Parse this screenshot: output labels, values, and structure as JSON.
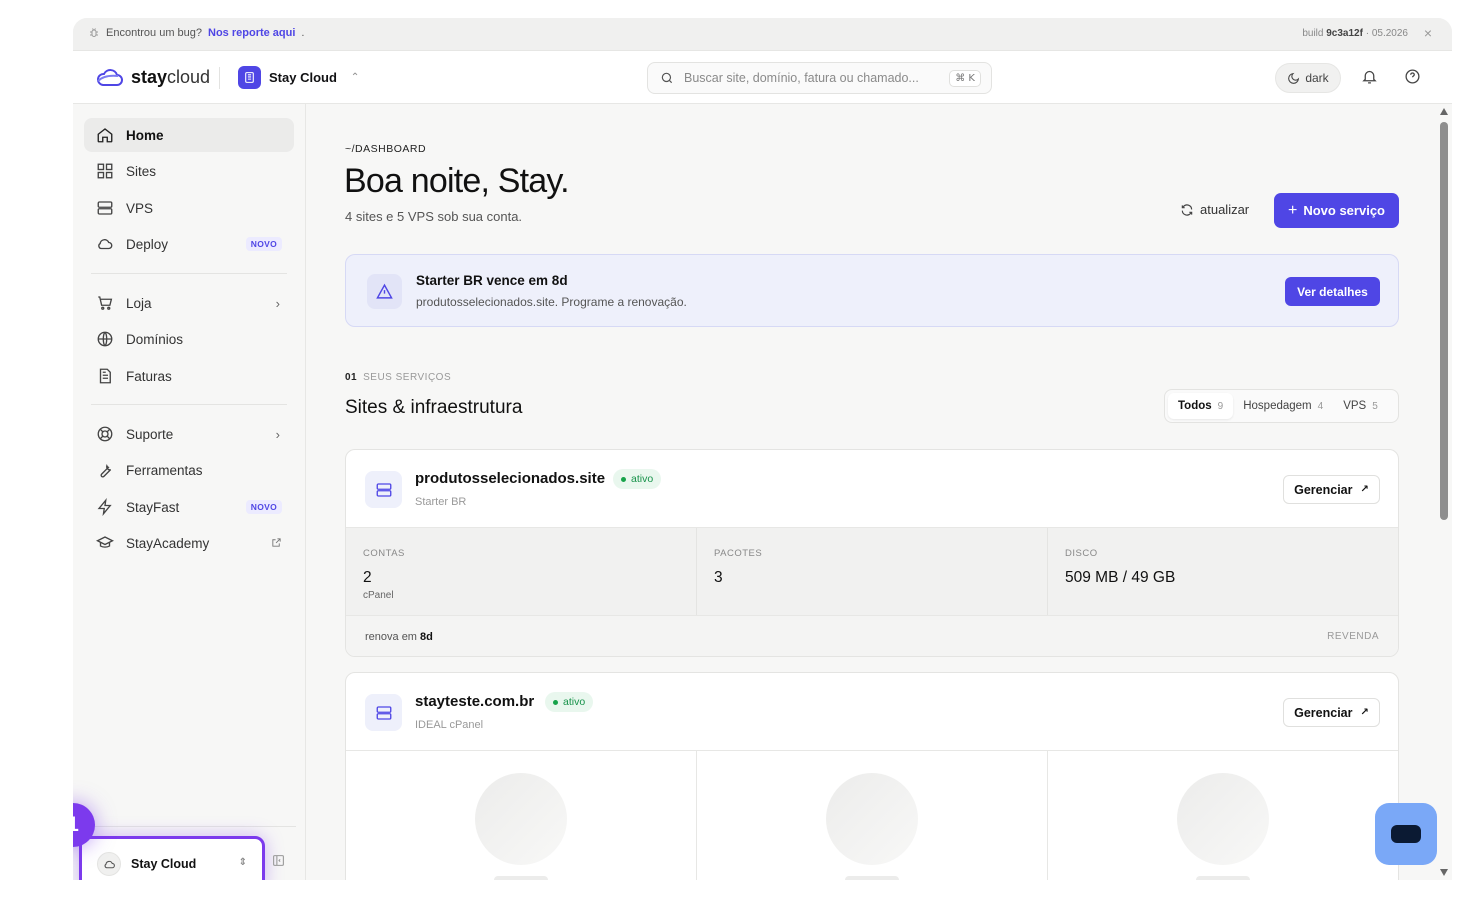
{
  "banner": {
    "bug_text": "Encontrou um bug?",
    "bug_link": "Nos reporte aqui",
    "bug_dot": ".",
    "build_label": "build",
    "build_hash": "9c3a12f",
    "build_date": "· 05.2026",
    "close": "×"
  },
  "header": {
    "logo_bold": "stay",
    "logo_light": "cloud",
    "org_name": "Stay Cloud",
    "search_placeholder": "Buscar site, domínio, fatura ou chamado...",
    "search_shortcut": "⌘ K",
    "theme_label": "dark"
  },
  "sidebar": {
    "items": [
      {
        "label": "Home",
        "icon": "home-icon",
        "active": true
      },
      {
        "label": "Sites",
        "icon": "grid-icon"
      },
      {
        "label": "VPS",
        "icon": "server-icon"
      },
      {
        "label": "Deploy",
        "icon": "cloud-icon",
        "tag": "NOVO"
      },
      {
        "label": "Loja",
        "icon": "cart-icon",
        "chevron": true
      },
      {
        "label": "Domínios",
        "icon": "globe-icon"
      },
      {
        "label": "Faturas",
        "icon": "invoice-icon"
      },
      {
        "label": "Suporte",
        "icon": "lifebuoy-icon",
        "chevron": true
      },
      {
        "label": "Ferramentas",
        "icon": "wrench-icon"
      },
      {
        "label": "StayFast",
        "icon": "bolt-icon",
        "tag": "NOVO"
      },
      {
        "label": "StayAcademy",
        "icon": "graduation-icon",
        "external": true
      }
    ],
    "org_switcher": "Stay Cloud",
    "step_number": "1"
  },
  "main": {
    "breadcrumb": "~/DASHBOARD",
    "greeting": "Boa noite, Stay.",
    "summary": "4 sites e 5 VPS sob sua conta.",
    "refresh_label": "atualizar",
    "new_service_label": "Novo serviço",
    "alert": {
      "title": "Starter BR vence em 8d",
      "text": "produtosselecionados.site. Programe a renovação.",
      "button": "Ver detalhes"
    },
    "section": {
      "number": "01",
      "kicker": "SEUS SERVIÇOS",
      "title": "Sites & infraestrutura"
    },
    "filters": [
      {
        "label": "Todos",
        "count": "9",
        "active": true
      },
      {
        "label": "Hospedagem",
        "count": "4"
      },
      {
        "label": "VPS",
        "count": "5"
      }
    ],
    "cards": [
      {
        "name": "produtosselecionados.site",
        "status": "ativo",
        "plan": "Starter BR",
        "manage_label": "Gerenciar",
        "stats": [
          {
            "label": "CONTAS",
            "value": "2",
            "note": "cPanel"
          },
          {
            "label": "PACOTES",
            "value": "3",
            "note": ""
          },
          {
            "label": "DISCO",
            "value": "509 MB / 49 GB",
            "note": ""
          }
        ],
        "renew_prefix": "renova em",
        "renew_value": "8d",
        "type": "REVENDA"
      },
      {
        "name": "stayteste.com.br",
        "status": "ativo",
        "plan": "IDEAL cPanel",
        "manage_label": "Gerenciar"
      }
    ]
  },
  "colors": {
    "accent": "#4f46e5",
    "highlight": "#7c3aed",
    "status_ok": "#17924a",
    "chat": "#7aa8f7"
  }
}
